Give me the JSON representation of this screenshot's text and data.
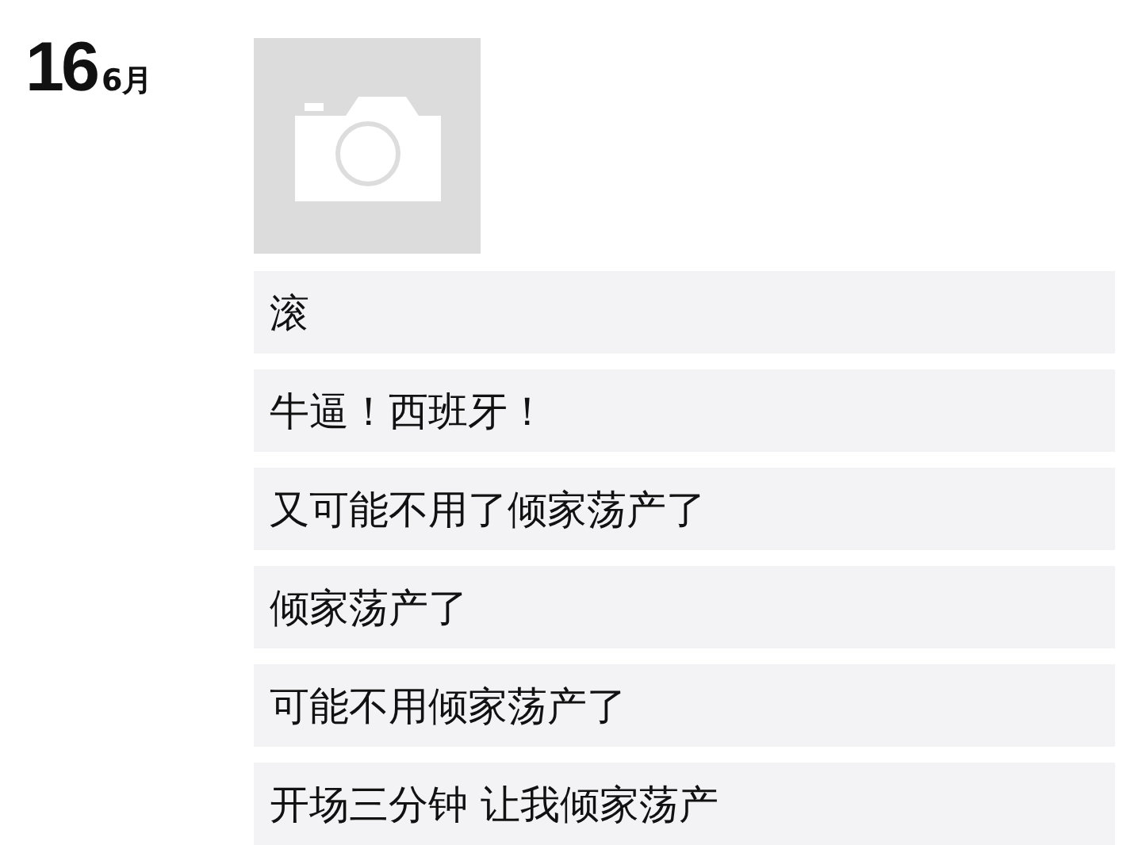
{
  "date": {
    "day": "16",
    "month": "6月"
  },
  "posts": [
    {
      "kind": "photo"
    },
    {
      "kind": "text",
      "text": "滚"
    },
    {
      "kind": "text",
      "text": "牛逼！西班牙！"
    },
    {
      "kind": "text",
      "text": "又可能不用了倾家荡产了"
    },
    {
      "kind": "text",
      "text": "倾家荡产了"
    },
    {
      "kind": "text",
      "text": "可能不用倾家荡产了"
    },
    {
      "kind": "text",
      "text": "开场三分钟 让我倾家荡产"
    }
  ]
}
